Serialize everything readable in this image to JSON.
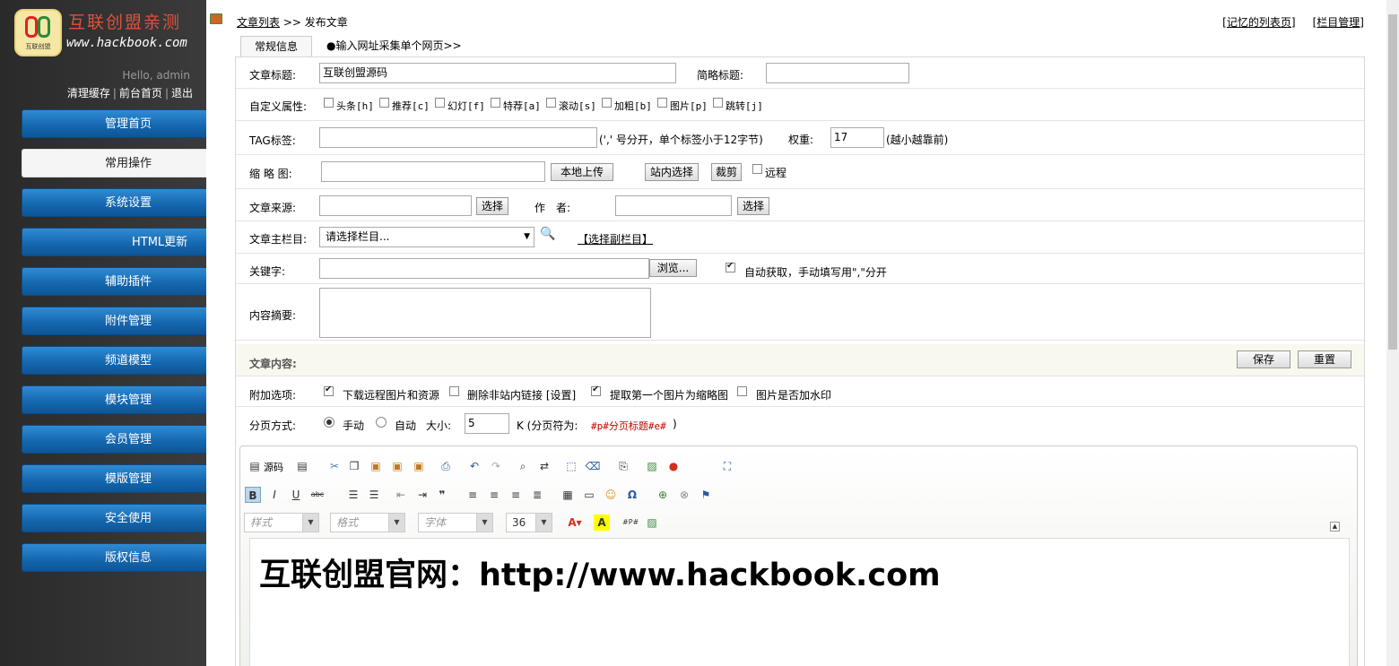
{
  "sidebar": {
    "logo_title": "互联创盟亲测",
    "logo_url": "www.hackbook.com",
    "logo_mark_text": "互联创盟",
    "hello": "Hello, admin",
    "links": [
      "清理缓存",
      "前台首页",
      "退出"
    ],
    "menu": [
      "管理首页",
      "常用操作",
      "系统设置",
      "HTML更新",
      "辅助插件",
      "附件管理",
      "频道模型",
      "模块管理",
      "会员管理",
      "模版管理",
      "安全使用",
      "版权信息"
    ],
    "active_index": 1
  },
  "header": {
    "crumb_link": "文章列表",
    "crumb_sep": ">>",
    "crumb_current": "发布文章",
    "right_links": [
      "[记忆的列表页]",
      "[栏目管理]"
    ]
  },
  "tabs": [
    "常规信息",
    "●输入网址采集单个网页>>"
  ],
  "form": {
    "title_label": "文章标题:",
    "title_value": "互联创盟源码",
    "short_title_label": "简略标题:",
    "attr_label": "自定义属性:",
    "attrs": [
      "头条[h]",
      "推荐[c]",
      "幻灯[f]",
      "特荐[a]",
      "滚动[s]",
      "加粗[b]",
      "图片[p]",
      "跳转[j]"
    ],
    "tag_label": "TAG标签:",
    "tag_hint": "(',' 号分开，单个标签小于12字节)",
    "weight_label": "权重:",
    "weight_value": "17",
    "weight_hint": "(越小越靠前)",
    "thumb_label": "缩 略 图:",
    "upload_btn": "本地上传",
    "site_select_btn": "站内选择",
    "crop_btn": "裁剪",
    "remote_label": "远程",
    "source_label": "文章来源:",
    "source_select_btn": "选择",
    "author_label": "作　者:",
    "author_select_btn": "选择",
    "column_label": "文章主栏目:",
    "column_value": "请选择栏目...",
    "sub_column_link": "【选择副栏目】",
    "keyword_label": "关键字:",
    "browse_btn": "浏览...",
    "auto_keyword_label": "自动获取，手动填写用\",\"分开",
    "summary_label": "内容摘要:",
    "content_label": "文章内容:",
    "save_btn": "保存",
    "reset_btn": "重置",
    "extra_label": "附加选项:",
    "extra_opts": [
      {
        "label": "下载远程图片和资源",
        "checked": true
      },
      {
        "label": "删除非站内链接 [设置]",
        "checked": false
      },
      {
        "label": "提取第一个图片为缩略图",
        "checked": true
      },
      {
        "label": "图片是否加水印",
        "checked": false
      }
    ],
    "page_label": "分页方式:",
    "page_manual": "手动",
    "page_auto": "自动",
    "page_size_label": "大小:",
    "page_size_value": "5",
    "page_hint_pre": "K (分页符为:",
    "page_hint_code": "#p#分页标题#e#",
    "page_hint_post": ")"
  },
  "editor": {
    "source_btn": "源码",
    "style_combo": "样式",
    "format_combo": "格式",
    "font_combo": "字体",
    "size_combo": "36",
    "content": "互联创盟官网：http://www.hackbook.com"
  }
}
